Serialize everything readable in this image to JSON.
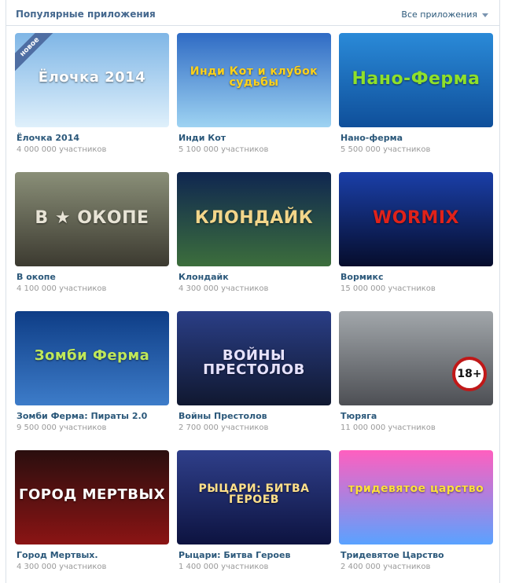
{
  "header": {
    "title": "Популярные приложения",
    "all_apps_label": "Все приложения"
  },
  "apps": [
    {
      "title": "Ёлочка 2014",
      "participants": "4 000 000 участников",
      "thumb_text": "Ёлочка 2014",
      "badge": "новое",
      "colors": {
        "top": "#7fb6e6",
        "bottom": "#dff0fb",
        "text": "#ffffff"
      }
    },
    {
      "title": "Инди Кот",
      "participants": "5 100 000 участников",
      "thumb_text": "Инди Кот и клубок судьбы",
      "colors": {
        "top": "#2f6bc4",
        "bottom": "#9ed3f2",
        "text": "#ffd21a"
      }
    },
    {
      "title": "Нано-ферма",
      "participants": "5 500 000 участников",
      "thumb_text": "Нано-Ферма",
      "colors": {
        "top": "#2a8ad8",
        "bottom": "#0f4f9a",
        "text": "#8fe02a"
      }
    },
    {
      "title": "В окопе",
      "participants": "4 100 000 участников",
      "thumb_text": "В ★ ОКОПЕ",
      "colors": {
        "top": "#8a8f78",
        "bottom": "#3c3a30",
        "text": "#e8e4d6"
      }
    },
    {
      "title": "Клондайк",
      "participants": "4 300 000 участников",
      "thumb_text": "КЛОНДАЙК",
      "colors": {
        "top": "#0f2650",
        "bottom": "#3c6e3c",
        "text": "#f2d58a"
      }
    },
    {
      "title": "Вормикс",
      "participants": "15 000 000 участников",
      "thumb_text": "WORMIX",
      "colors": {
        "top": "#1a3fa8",
        "bottom": "#060d2c",
        "text": "#e0221a"
      }
    },
    {
      "title": "Зомби Ферма: Пираты 2.0",
      "participants": "9 500 000 участников",
      "thumb_text": "Зомби Ферма",
      "colors": {
        "top": "#0e3d86",
        "bottom": "#3d7cc9",
        "text": "#bfe85a"
      }
    },
    {
      "title": "Войны Престолов",
      "participants": "2 700 000 участников",
      "thumb_text": "ВОЙНЫ ПРЕСТОЛОВ",
      "colors": {
        "top": "#2a3e86",
        "bottom": "#101830",
        "text": "#e6e2ff"
      }
    },
    {
      "title": "Тюряга",
      "participants": "11 000 000 участников",
      "thumb_text": "",
      "age_badge": "18+",
      "colors": {
        "top": "#a2a7ab",
        "bottom": "#4d4f54",
        "text": "#ffffff"
      }
    },
    {
      "title": "Город Мертвых.",
      "participants": "4 300 000 участников",
      "thumb_text": "ГОРОД МЕРТВЫХ",
      "colors": {
        "top": "#2a0e0e",
        "bottom": "#8b1414",
        "text": "#ffffff"
      }
    },
    {
      "title": "Рыцари: Битва Героев",
      "participants": "1 400 000 участников",
      "thumb_text": "РЫЦАРИ: БИТВА ГЕРОЕВ",
      "colors": {
        "top": "#2f3f8a",
        "bottom": "#0d1340",
        "text": "#ffe08a"
      }
    },
    {
      "title": "Тридевятое Царство",
      "participants": "2 400 000 участников",
      "thumb_text": "тридевятое царство",
      "colors": {
        "top": "#ff5fbf",
        "bottom": "#5aa2ff",
        "text": "#ffe03a"
      }
    }
  ]
}
